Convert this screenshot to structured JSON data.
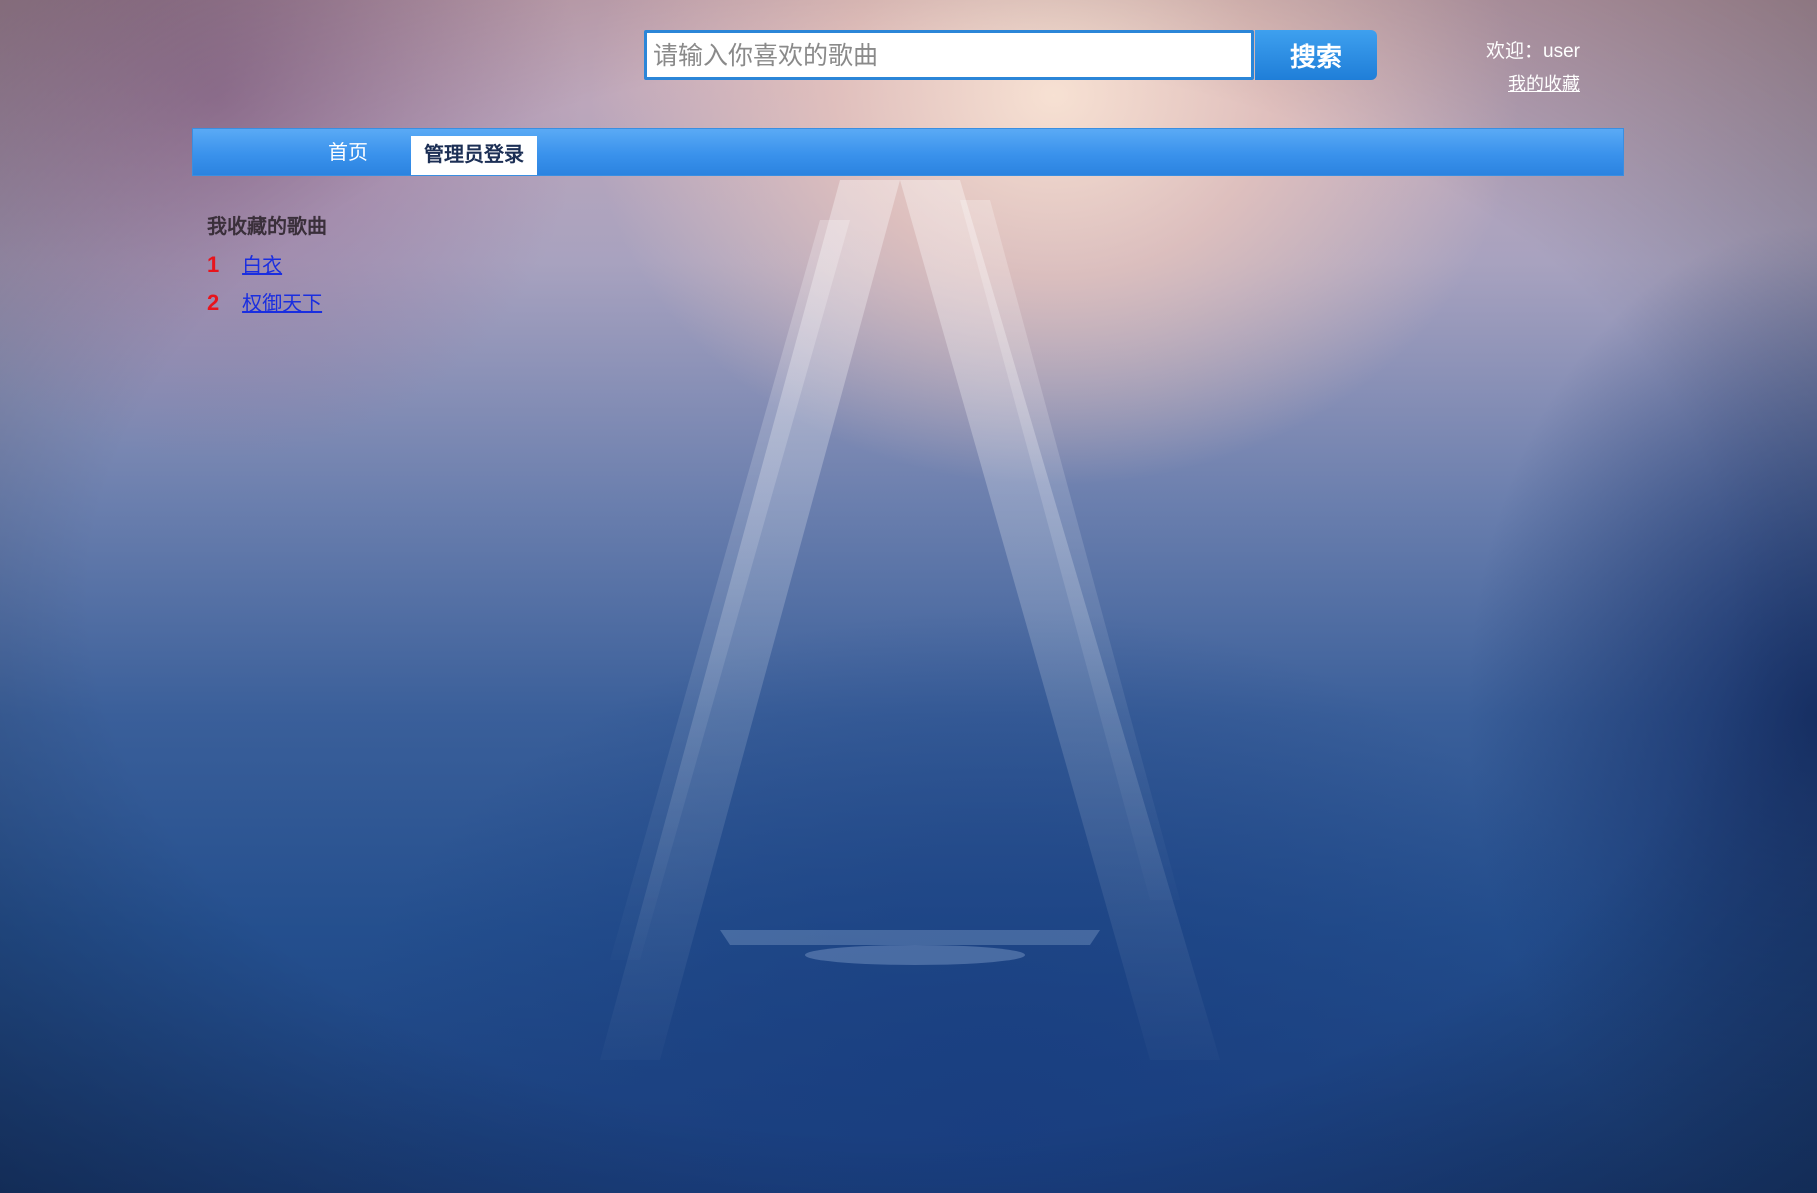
{
  "search": {
    "placeholder": "请输入你喜欢的歌曲",
    "button_label": "搜索"
  },
  "user": {
    "welcome": "欢迎：user",
    "favorites_link": "我的收藏"
  },
  "nav": {
    "home": "首页",
    "admin_login": "管理员登录"
  },
  "content": {
    "title": "我收藏的歌曲",
    "songs": [
      {
        "num": "1",
        "name": "白衣"
      },
      {
        "num": "2",
        "name": "权御天下"
      }
    ]
  },
  "colors": {
    "accent": "#2b86d8",
    "nav_bar": "#3a92ec",
    "song_number": "#e8141c",
    "song_link": "#1a2ee0"
  }
}
